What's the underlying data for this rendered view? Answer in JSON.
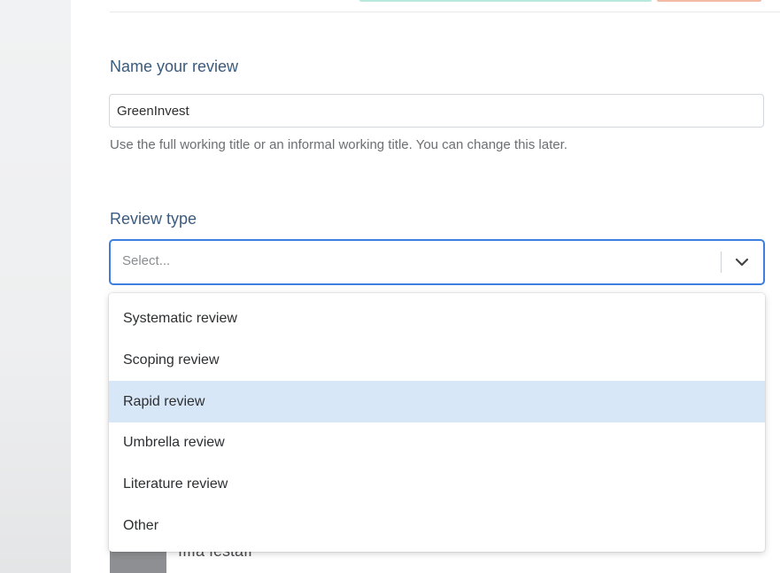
{
  "form": {
    "name_label": "Name your review",
    "name_value": "GreenInvest",
    "name_help": "Use the full working title or an informal working title. You can change this later.",
    "type_label": "Review type",
    "type_placeholder": "Select..."
  },
  "dropdown": {
    "options": [
      {
        "label": "Systematic review"
      },
      {
        "label": "Scoping review"
      },
      {
        "label": "Rapid review",
        "highlighted": true
      },
      {
        "label": "Umbrella review"
      },
      {
        "label": "Literature review"
      },
      {
        "label": "Other"
      }
    ]
  },
  "background": {
    "partial_user_name": "ııııa ıestaıı"
  },
  "colors": {
    "label": "#3b5a7e",
    "focus_border": "#3d7ee0",
    "highlight": "#d8e7f7"
  },
  "icons": {
    "select_toggle": "chevron-down-icon"
  }
}
